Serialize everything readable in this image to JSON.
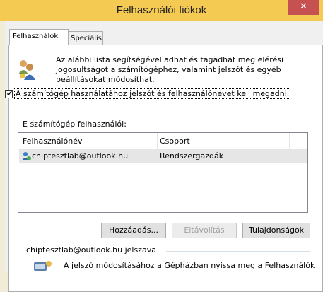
{
  "window": {
    "title": "Felhasználói fiókok",
    "close_glyph": "✕"
  },
  "tabs": [
    {
      "label": "Felhasználók"
    },
    {
      "label": "Speciális"
    }
  ],
  "intro": {
    "lines": [
      "Az alábbi lista segítségével adhat és tagadhat meg elérési",
      "jogosultságot a számítógéphez, valamint jelszót és egyéb",
      "beállításokat módosíthat."
    ]
  },
  "require_login": {
    "checked": true,
    "check_glyph": "✔",
    "label": "A számítógép használatához jelszót és felhasználónevet kell megadni."
  },
  "users_section": {
    "label": "E számítógép felhasználói:"
  },
  "users_table": {
    "columns": [
      "Felhasználónév",
      "Csoport"
    ],
    "rows": [
      {
        "name": "chiptesztlab@outlook.hu",
        "group": "Rendszergazdák"
      }
    ]
  },
  "buttons": {
    "add": "Hozzáadás...",
    "remove": "Eltávolítás",
    "properties": "Tulajdonságok"
  },
  "password_group": {
    "title": "chiptesztlab@outlook.hu jelszava",
    "text": "A jelszó módosításához a Gépházban nyissa meg a Felhasználók"
  },
  "colors": {
    "titlebar": "#f4ca53",
    "close": "#c75050",
    "selected_row": "#e6e6e6",
    "link_blue": "#0066cc"
  }
}
